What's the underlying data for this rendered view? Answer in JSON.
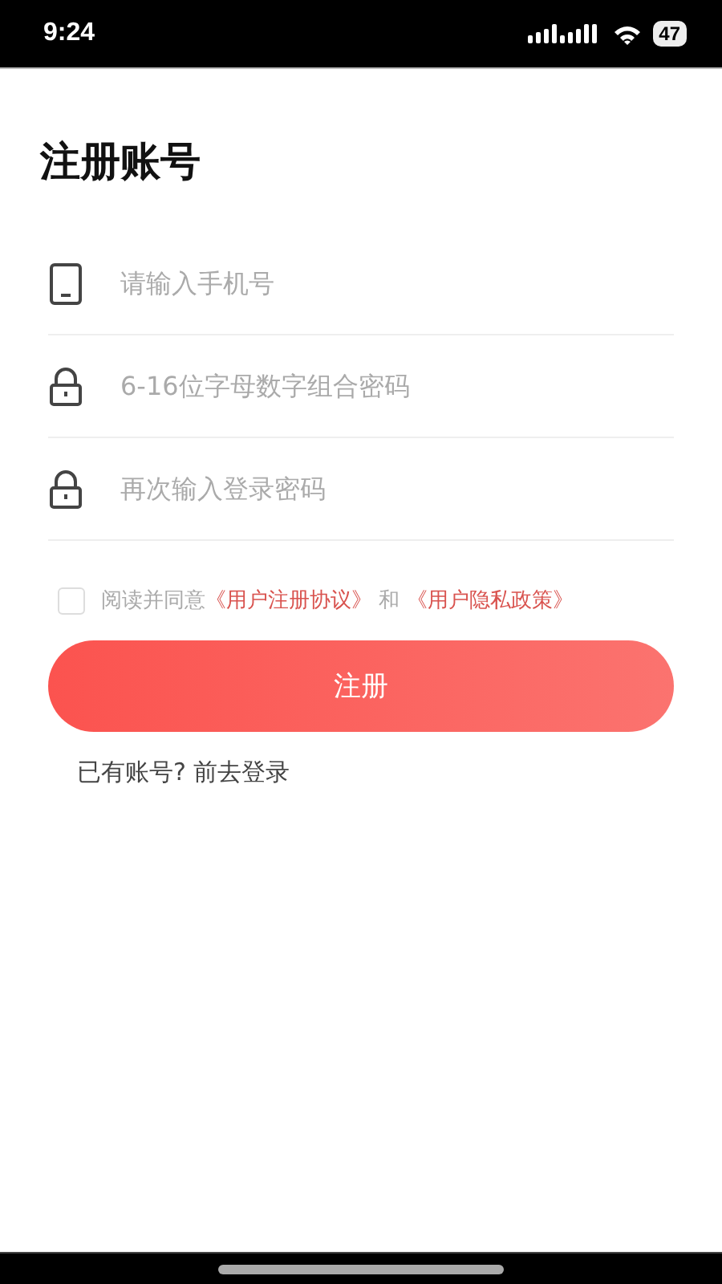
{
  "status_bar": {
    "time": "9:24",
    "battery": "47"
  },
  "title": "注册账号",
  "fields": [
    {
      "kind": "phone",
      "placeholder": "请输入手机号"
    },
    {
      "kind": "lock",
      "placeholder": "6-16位字母数字组合密码"
    },
    {
      "kind": "lock",
      "placeholder": "再次输入登录密码"
    }
  ],
  "agreement": {
    "checked": false,
    "prefix": "阅读并同意",
    "link_1": "《用户注册协议》",
    "joiner": "和",
    "link_2": "《用户隐私政策》"
  },
  "submit_button": "注册",
  "login_link": "已有账号? 前去登录"
}
